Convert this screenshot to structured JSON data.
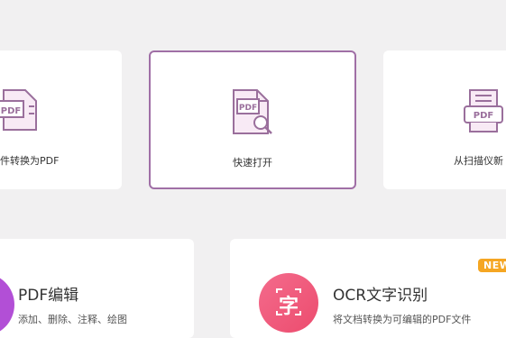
{
  "tiles": [
    {
      "label": "件转换为PDF",
      "icon": "pdf-convert-icon"
    },
    {
      "label": "快速打开",
      "icon": "pdf-search-icon"
    },
    {
      "label": "从扫描仪新",
      "icon": "scanner-pdf-icon"
    }
  ],
  "features": [
    {
      "title": "PDF编辑",
      "desc": "添加、删除、注释、绘图",
      "icon": "pdf-edit-icon"
    },
    {
      "title": "OCR文字识别",
      "desc": "将文档转换为可编辑的PDF文件",
      "icon": "ocr-character-icon",
      "icon_text": "字",
      "badge": "NEW"
    }
  ],
  "colors": {
    "accent": "#a06fa6",
    "badge": "#f5a623",
    "ocr": "#f0587a",
    "edit": "#b24fd6"
  }
}
